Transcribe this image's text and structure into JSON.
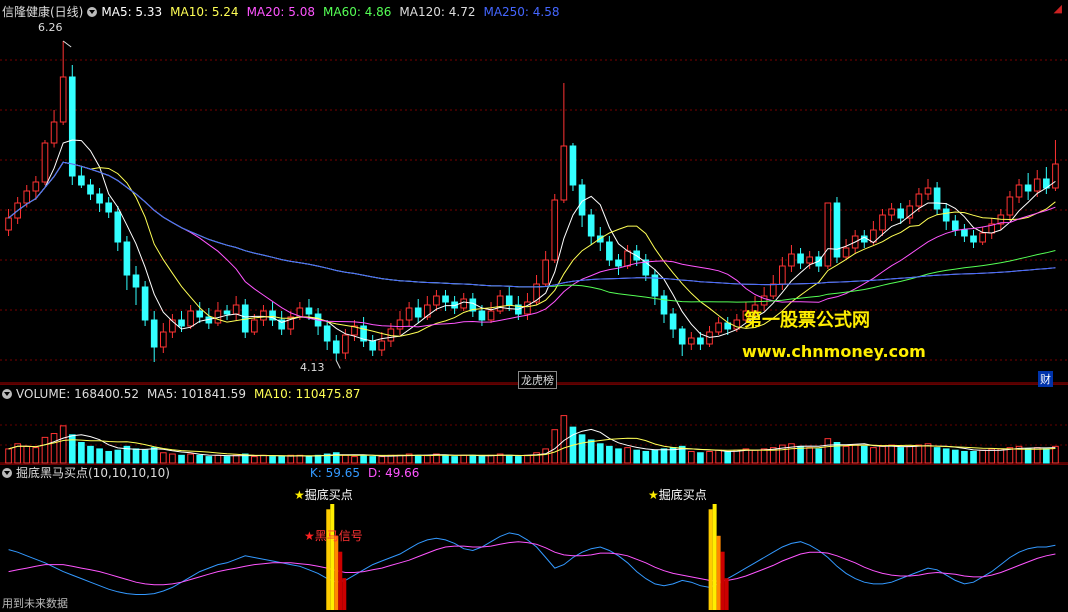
{
  "main_header": {
    "name": "信隆健康(日线)",
    "items": [
      {
        "label": "MA5: 5.33",
        "color": "#ffffff"
      },
      {
        "label": "MA10: 5.24",
        "color": "#ffff55"
      },
      {
        "label": "MA20: 5.08",
        "color": "#ff55ff"
      },
      {
        "label": "MA60: 4.86",
        "color": "#55ff55"
      },
      {
        "label": "MA120: 4.72",
        "color": "#dddddd"
      },
      {
        "label": "MA250: 4.58",
        "color": "#4466ff"
      }
    ]
  },
  "volume_header": {
    "items": [
      {
        "label": "VOLUME: 168400.52",
        "color": "#dddddd"
      },
      {
        "label": "MA5: 101841.59",
        "color": "#dddddd"
      },
      {
        "label": "MA10: 110475.87",
        "color": "#ffff55"
      }
    ]
  },
  "indicator_header": {
    "name": "掘底黑马买点(10,10,10,10)",
    "items": [
      {
        "label": "K: 59.65",
        "color": "#3399ff"
      },
      {
        "label": "D: 49.66",
        "color": "#ff55ff"
      }
    ]
  },
  "annotations": {
    "high_price": "6.26",
    "low_price": "4.13",
    "event_tag": "龙虎榜",
    "finance_tag": "财",
    "signal_buy_1": "掘底买点",
    "signal_black_horse": "黑马信号",
    "signal_buy_2": "掘底买点",
    "footer_note": "用到未来数据"
  },
  "watermark": {
    "line1": "第一股票公式网",
    "line2": "www.chnmoney.com"
  },
  "colors": {
    "up": "#ff3333",
    "down": "#33ffff",
    "ma5": "#ffffff",
    "ma10": "#ffff55",
    "ma20": "#ff55ff",
    "ma60": "#55ff55",
    "ma120": "#dddddd",
    "ma250": "#4466ff",
    "k_line": "#3399ff",
    "d_line": "#ff55ff",
    "grid": "#aa0000"
  },
  "chart_data": {
    "type": "candlestick",
    "price_range": [
      4.0,
      6.4
    ],
    "candles": [
      [
        5.0,
        5.08,
        4.96,
        5.14
      ],
      [
        5.08,
        5.18,
        5.04,
        5.22
      ],
      [
        5.18,
        5.26,
        5.15,
        5.3
      ],
      [
        5.26,
        5.32,
        5.2,
        5.36
      ],
      [
        5.32,
        5.58,
        5.3,
        5.6
      ],
      [
        5.58,
        5.72,
        5.55,
        5.8
      ],
      [
        5.72,
        6.02,
        5.7,
        6.26
      ],
      [
        6.02,
        5.36,
        5.3,
        6.1
      ],
      [
        5.36,
        5.3,
        5.28,
        5.42
      ],
      [
        5.3,
        5.24,
        5.2,
        5.34
      ],
      [
        5.24,
        5.18,
        5.12,
        5.28
      ],
      [
        5.18,
        5.12,
        5.08,
        5.22
      ],
      [
        5.12,
        4.92,
        4.86,
        5.16
      ],
      [
        4.92,
        4.7,
        4.6,
        4.96
      ],
      [
        4.7,
        4.62,
        4.5,
        4.76
      ],
      [
        4.62,
        4.4,
        4.36,
        4.66
      ],
      [
        4.4,
        4.22,
        4.12,
        4.46
      ],
      [
        4.22,
        4.32,
        4.18,
        4.38
      ],
      [
        4.32,
        4.4,
        4.28,
        4.44
      ],
      [
        4.4,
        4.36,
        4.32,
        4.46
      ],
      [
        4.36,
        4.46,
        4.34,
        4.5
      ],
      [
        4.46,
        4.42,
        4.38,
        4.52
      ],
      [
        4.42,
        4.38,
        4.34,
        4.48
      ],
      [
        4.38,
        4.46,
        4.36,
        4.52
      ],
      [
        4.46,
        4.44,
        4.4,
        4.5
      ],
      [
        4.44,
        4.5,
        4.4,
        4.56
      ],
      [
        4.5,
        4.32,
        4.28,
        4.54
      ],
      [
        4.32,
        4.4,
        4.3,
        4.44
      ],
      [
        4.4,
        4.46,
        4.36,
        4.5
      ],
      [
        4.46,
        4.4,
        4.36,
        4.52
      ],
      [
        4.4,
        4.34,
        4.3,
        4.46
      ],
      [
        4.34,
        4.42,
        4.3,
        4.46
      ],
      [
        4.42,
        4.48,
        4.4,
        4.52
      ],
      [
        4.48,
        4.44,
        4.4,
        4.54
      ],
      [
        4.44,
        4.36,
        4.3,
        4.48
      ],
      [
        4.36,
        4.26,
        4.2,
        4.4
      ],
      [
        4.26,
        4.18,
        4.13,
        4.3
      ],
      [
        4.18,
        4.3,
        4.14,
        4.34
      ],
      [
        4.3,
        4.36,
        4.26,
        4.4
      ],
      [
        4.36,
        4.26,
        4.22,
        4.42
      ],
      [
        4.26,
        4.2,
        4.16,
        4.3
      ],
      [
        4.2,
        4.26,
        4.16,
        4.32
      ],
      [
        4.26,
        4.34,
        4.22,
        4.38
      ],
      [
        4.34,
        4.4,
        4.3,
        4.46
      ],
      [
        4.4,
        4.48,
        4.36,
        4.52
      ],
      [
        4.48,
        4.42,
        4.38,
        4.54
      ],
      [
        4.42,
        4.5,
        4.4,
        4.56
      ],
      [
        4.5,
        4.56,
        4.46,
        4.6
      ],
      [
        4.56,
        4.52,
        4.46,
        4.6
      ],
      [
        4.52,
        4.48,
        4.44,
        4.56
      ],
      [
        4.48,
        4.54,
        4.46,
        4.58
      ],
      [
        4.54,
        4.46,
        4.42,
        4.58
      ],
      [
        4.46,
        4.4,
        4.36,
        4.5
      ],
      [
        4.4,
        4.46,
        4.38,
        4.52
      ],
      [
        4.46,
        4.56,
        4.44,
        4.6
      ],
      [
        4.56,
        4.5,
        4.46,
        4.62
      ],
      [
        4.5,
        4.44,
        4.4,
        4.56
      ],
      [
        4.44,
        4.52,
        4.4,
        4.58
      ],
      [
        4.52,
        4.64,
        4.5,
        4.7
      ],
      [
        4.64,
        4.8,
        4.62,
        4.86
      ],
      [
        4.8,
        5.2,
        4.78,
        5.24
      ],
      [
        5.2,
        5.56,
        5.18,
        5.98
      ],
      [
        5.56,
        5.3,
        5.26,
        5.58
      ],
      [
        5.3,
        5.1,
        5.02,
        5.34
      ],
      [
        5.1,
        4.96,
        4.9,
        5.14
      ],
      [
        4.96,
        4.92,
        4.86,
        5.02
      ],
      [
        4.92,
        4.8,
        4.76,
        4.96
      ],
      [
        4.8,
        4.76,
        4.7,
        4.84
      ],
      [
        4.76,
        4.86,
        4.74,
        4.9
      ],
      [
        4.86,
        4.8,
        4.76,
        4.9
      ],
      [
        4.8,
        4.7,
        4.66,
        4.84
      ],
      [
        4.7,
        4.56,
        4.5,
        4.74
      ],
      [
        4.56,
        4.44,
        4.38,
        4.6
      ],
      [
        4.44,
        4.34,
        4.28,
        4.48
      ],
      [
        4.34,
        4.24,
        4.16,
        4.36
      ],
      [
        4.24,
        4.28,
        4.2,
        4.32
      ],
      [
        4.28,
        4.24,
        4.2,
        4.32
      ],
      [
        4.24,
        4.32,
        4.22,
        4.36
      ],
      [
        4.32,
        4.38,
        4.3,
        4.42
      ],
      [
        4.38,
        4.34,
        4.3,
        4.42
      ],
      [
        4.34,
        4.4,
        4.32,
        4.44
      ],
      [
        4.4,
        4.46,
        4.38,
        4.52
      ],
      [
        4.46,
        4.5,
        4.42,
        4.56
      ],
      [
        4.5,
        4.56,
        4.46,
        4.62
      ],
      [
        4.56,
        4.64,
        4.54,
        4.7
      ],
      [
        4.64,
        4.76,
        4.6,
        4.82
      ],
      [
        4.76,
        4.84,
        4.72,
        4.9
      ],
      [
        4.84,
        4.78,
        4.74,
        4.88
      ],
      [
        4.78,
        4.82,
        4.74,
        4.86
      ],
      [
        4.82,
        4.76,
        4.72,
        4.86
      ],
      [
        4.76,
        5.18,
        4.74,
        5.18
      ],
      [
        5.18,
        4.82,
        4.78,
        5.22
      ],
      [
        4.82,
        4.88,
        4.8,
        4.94
      ],
      [
        4.88,
        4.96,
        4.84,
        5.0
      ],
      [
        4.96,
        4.92,
        4.88,
        5.0
      ],
      [
        4.92,
        5.0,
        4.9,
        5.06
      ],
      [
        5.0,
        5.1,
        4.96,
        5.14
      ],
      [
        5.1,
        5.14,
        5.06,
        5.18
      ],
      [
        5.14,
        5.08,
        5.04,
        5.18
      ],
      [
        5.08,
        5.16,
        5.04,
        5.2
      ],
      [
        5.16,
        5.24,
        5.12,
        5.28
      ],
      [
        5.24,
        5.28,
        5.2,
        5.34
      ],
      [
        5.28,
        5.14,
        5.1,
        5.32
      ],
      [
        5.14,
        5.06,
        5.0,
        5.18
      ],
      [
        5.06,
        5.0,
        4.96,
        5.1
      ],
      [
        5.0,
        4.96,
        4.92,
        5.04
      ],
      [
        4.96,
        4.92,
        4.88,
        5.0
      ],
      [
        4.92,
        4.98,
        4.9,
        5.02
      ],
      [
        4.98,
        5.04,
        4.94,
        5.08
      ],
      [
        5.04,
        5.1,
        5.0,
        5.14
      ],
      [
        5.1,
        5.22,
        5.06,
        5.26
      ],
      [
        5.22,
        5.3,
        5.18,
        5.34
      ],
      [
        5.3,
        5.26,
        5.2,
        5.38
      ],
      [
        5.26,
        5.34,
        5.22,
        5.4
      ],
      [
        5.34,
        5.28,
        5.24,
        5.42
      ],
      [
        5.28,
        5.44,
        5.26,
        5.6
      ]
    ],
    "volume": [
      0.22,
      0.3,
      0.26,
      0.24,
      0.4,
      0.46,
      0.58,
      0.44,
      0.32,
      0.26,
      0.22,
      0.18,
      0.2,
      0.26,
      0.22,
      0.2,
      0.24,
      0.16,
      0.14,
      0.12,
      0.14,
      0.12,
      0.1,
      0.12,
      0.1,
      0.12,
      0.14,
      0.1,
      0.12,
      0.1,
      0.1,
      0.12,
      0.12,
      0.1,
      0.12,
      0.14,
      0.16,
      0.12,
      0.1,
      0.12,
      0.1,
      0.1,
      0.12,
      0.12,
      0.14,
      0.12,
      0.12,
      0.14,
      0.12,
      0.1,
      0.12,
      0.12,
      0.1,
      0.12,
      0.14,
      0.12,
      0.1,
      0.12,
      0.16,
      0.22,
      0.52,
      0.74,
      0.56,
      0.44,
      0.36,
      0.3,
      0.26,
      0.22,
      0.24,
      0.2,
      0.18,
      0.2,
      0.22,
      0.24,
      0.26,
      0.18,
      0.16,
      0.18,
      0.2,
      0.18,
      0.2,
      0.22,
      0.2,
      0.22,
      0.24,
      0.28,
      0.3,
      0.26,
      0.24,
      0.22,
      0.38,
      0.32,
      0.26,
      0.28,
      0.26,
      0.24,
      0.26,
      0.28,
      0.24,
      0.26,
      0.28,
      0.3,
      0.24,
      0.22,
      0.2,
      0.18,
      0.18,
      0.2,
      0.22,
      0.22,
      0.24,
      0.26,
      0.22,
      0.24,
      0.22,
      0.26
    ],
    "signal_bars": [
      {
        "index": 36,
        "kind": "buy"
      },
      {
        "index": 78,
        "kind": "buy"
      }
    ],
    "k_line": [
      0.55,
      0.52,
      0.48,
      0.44,
      0.4,
      0.35,
      0.3,
      0.26,
      0.22,
      0.18,
      0.14,
      0.1,
      0.07,
      0.05,
      0.04,
      0.04,
      0.05,
      0.08,
      0.12,
      0.18,
      0.24,
      0.3,
      0.34,
      0.38,
      0.4,
      0.44,
      0.48,
      0.46,
      0.44,
      0.42,
      0.4,
      0.38,
      0.36,
      0.32,
      0.28,
      0.22,
      0.18,
      0.2,
      0.26,
      0.32,
      0.38,
      0.42,
      0.46,
      0.5,
      0.56,
      0.62,
      0.66,
      0.68,
      0.66,
      0.62,
      0.56,
      0.54,
      0.58,
      0.64,
      0.7,
      0.74,
      0.72,
      0.66,
      0.58,
      0.46,
      0.34,
      0.38,
      0.46,
      0.52,
      0.56,
      0.58,
      0.54,
      0.48,
      0.4,
      0.3,
      0.22,
      0.16,
      0.14,
      0.16,
      0.2,
      0.18,
      0.14,
      0.12,
      0.16,
      0.22,
      0.28,
      0.34,
      0.4,
      0.46,
      0.52,
      0.58,
      0.62,
      0.64,
      0.6,
      0.54,
      0.46,
      0.36,
      0.28,
      0.22,
      0.18,
      0.16,
      0.16,
      0.18,
      0.22,
      0.26,
      0.3,
      0.34,
      0.32,
      0.26,
      0.2,
      0.16,
      0.18,
      0.24,
      0.3,
      0.38,
      0.46,
      0.52,
      0.56,
      0.58,
      0.58,
      0.6
    ],
    "d_line": [
      0.3,
      0.32,
      0.34,
      0.36,
      0.38,
      0.38,
      0.38,
      0.36,
      0.34,
      0.32,
      0.3,
      0.27,
      0.24,
      0.21,
      0.18,
      0.16,
      0.15,
      0.15,
      0.16,
      0.18,
      0.21,
      0.24,
      0.27,
      0.3,
      0.32,
      0.34,
      0.36,
      0.38,
      0.39,
      0.4,
      0.4,
      0.4,
      0.39,
      0.38,
      0.36,
      0.34,
      0.31,
      0.29,
      0.29,
      0.3,
      0.32,
      0.34,
      0.37,
      0.4,
      0.43,
      0.47,
      0.51,
      0.55,
      0.58,
      0.59,
      0.59,
      0.58,
      0.58,
      0.59,
      0.61,
      0.63,
      0.64,
      0.63,
      0.61,
      0.57,
      0.52,
      0.49,
      0.48,
      0.48,
      0.49,
      0.51,
      0.51,
      0.5,
      0.48,
      0.44,
      0.4,
      0.35,
      0.31,
      0.28,
      0.26,
      0.24,
      0.22,
      0.2,
      0.19,
      0.2,
      0.22,
      0.25,
      0.29,
      0.33,
      0.37,
      0.42,
      0.46,
      0.5,
      0.52,
      0.52,
      0.51,
      0.48,
      0.44,
      0.4,
      0.35,
      0.31,
      0.28,
      0.26,
      0.25,
      0.25,
      0.26,
      0.28,
      0.29,
      0.28,
      0.27,
      0.25,
      0.24,
      0.24,
      0.26,
      0.29,
      0.33,
      0.37,
      0.41,
      0.45,
      0.48,
      0.5
    ]
  }
}
